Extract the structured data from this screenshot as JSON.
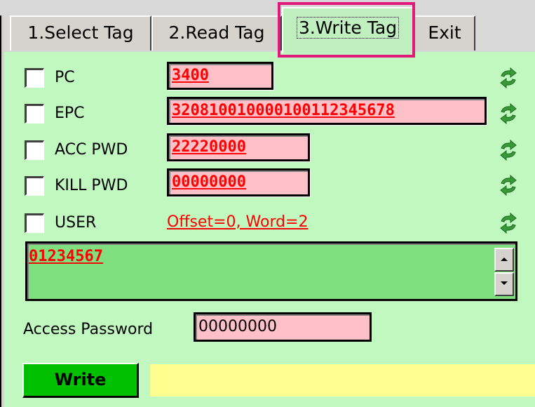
{
  "tabs": [
    {
      "label": "1.Select Tag",
      "active": false
    },
    {
      "label": "2.Read Tag",
      "active": false
    },
    {
      "label": "3.Write Tag",
      "active": true
    },
    {
      "label": "Exit",
      "active": false
    }
  ],
  "fields": {
    "pc": {
      "label": "PC",
      "value": "3400"
    },
    "epc": {
      "label": "EPC",
      "value": "320810010000100112345678"
    },
    "acc_pwd": {
      "label": "ACC PWD",
      "value": "22220000"
    },
    "kill_pwd": {
      "label": "KILL PWD",
      "value": "00000000"
    },
    "user": {
      "label": "USER",
      "link": "Offset=0, Word=2"
    }
  },
  "user_data": "01234567",
  "access_password": {
    "label": "Access Password",
    "value": "00000000"
  },
  "write_button": "Write",
  "status_text": "",
  "colors": {
    "panel": "#c0f8c0",
    "field": "#ffc0c8",
    "write_button": "#00c000",
    "status": "#ffff90",
    "highlight": "#e0197a"
  },
  "icons": {
    "refresh": "refresh-icon",
    "scroll_up": "scroll-up-icon",
    "scroll_down": "scroll-down-icon"
  }
}
